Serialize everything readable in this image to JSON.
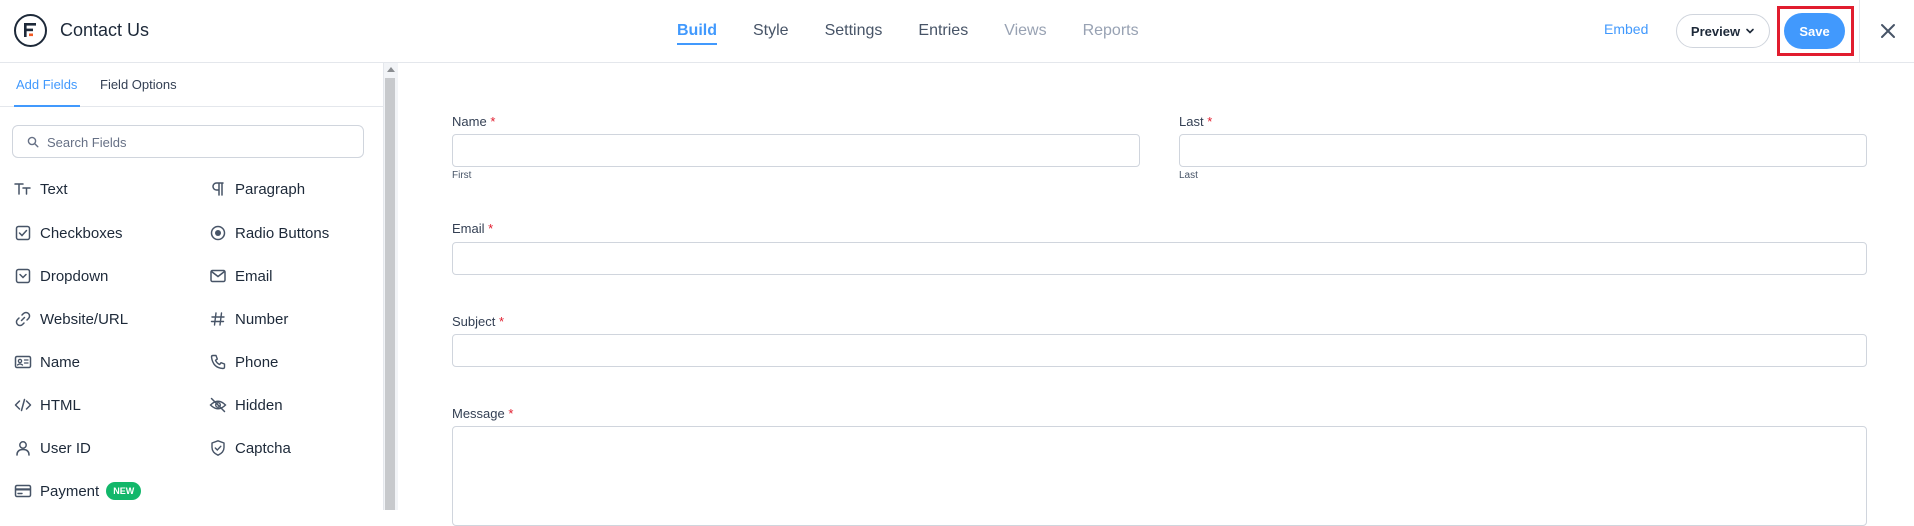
{
  "app": {
    "title": "Contact Us"
  },
  "nav": {
    "tabs": [
      {
        "label": "Build",
        "state": "active"
      },
      {
        "label": "Style",
        "state": "normal"
      },
      {
        "label": "Settings",
        "state": "normal"
      },
      {
        "label": "Entries",
        "state": "normal"
      },
      {
        "label": "Views",
        "state": "disabled"
      },
      {
        "label": "Reports",
        "state": "disabled"
      }
    ]
  },
  "toolbar": {
    "embed_label": "Embed",
    "preview_label": "Preview",
    "save_label": "Save"
  },
  "sidebar": {
    "tabs": [
      {
        "label": "Add Fields",
        "active": true
      },
      {
        "label": "Field Options",
        "active": false
      }
    ],
    "search": {
      "placeholder": "Search Fields",
      "value": ""
    },
    "fields": [
      {
        "label": "Text",
        "icon": "text-type-icon"
      },
      {
        "label": "Paragraph",
        "icon": "pilcrow-icon"
      },
      {
        "label": "Checkboxes",
        "icon": "checkbox-icon"
      },
      {
        "label": "Radio Buttons",
        "icon": "radio-icon"
      },
      {
        "label": "Dropdown",
        "icon": "dropdown-icon"
      },
      {
        "label": "Email",
        "icon": "envelope-icon"
      },
      {
        "label": "Website/URL",
        "icon": "link-icon"
      },
      {
        "label": "Number",
        "icon": "hash-icon"
      },
      {
        "label": "Name",
        "icon": "id-card-icon"
      },
      {
        "label": "Phone",
        "icon": "phone-icon"
      },
      {
        "label": "HTML",
        "icon": "code-icon"
      },
      {
        "label": "Hidden",
        "icon": "eye-off-icon"
      },
      {
        "label": "User ID",
        "icon": "user-icon"
      },
      {
        "label": "Captcha",
        "icon": "shield-check-icon"
      },
      {
        "label": "Payment",
        "icon": "credit-card-icon",
        "badge": "NEW"
      }
    ]
  },
  "form": {
    "required_mark": "*",
    "name": {
      "label": "Name",
      "first_sublabel": "First"
    },
    "last": {
      "label": "Last",
      "sublabel": "Last"
    },
    "email": {
      "label": "Email"
    },
    "subject": {
      "label": "Subject"
    },
    "message": {
      "label": "Message"
    }
  },
  "colors": {
    "accent": "#4199fd",
    "highlight_box": "#e11d2e",
    "new_badge": "#12b76a",
    "required": "#e11d2e"
  }
}
